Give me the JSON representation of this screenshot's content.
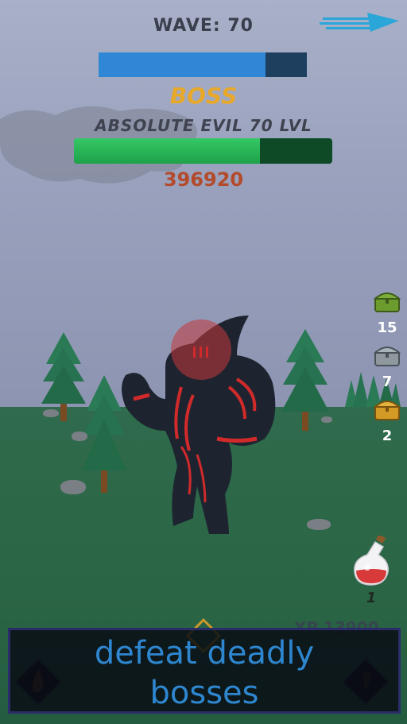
{
  "hud": {
    "wave_label": "WAVE: 70",
    "wave_progress": 0.8,
    "boss_tag": "BOSS",
    "boss_name": "ABSOLUTE EVIL 70 LVL",
    "boss_hp_fraction": 0.72,
    "boss_hp_value": "396920",
    "speed_icon": "fast-forward-arrow-icon"
  },
  "chests": [
    {
      "name": "green-chest-icon",
      "count": "15",
      "color": "#7dae3a"
    },
    {
      "name": "silver-chest-icon",
      "count": "7",
      "color": "#a9b1b9"
    },
    {
      "name": "gold-chest-icon",
      "count": "2",
      "color": "#e3b23c"
    }
  ],
  "potion": {
    "icon": "red-potion-icon",
    "count": "1"
  },
  "xp": {
    "label": "XP 13900"
  },
  "banner": {
    "line1": "defeat deadly",
    "line2": "bosses"
  },
  "colors": {
    "wave_bar": "#2f87d6",
    "hp_bar": "#2fbd5f",
    "boss_tag": "#e8a92a",
    "hp_text": "#b34a2a",
    "banner_text": "#2e86cf"
  }
}
